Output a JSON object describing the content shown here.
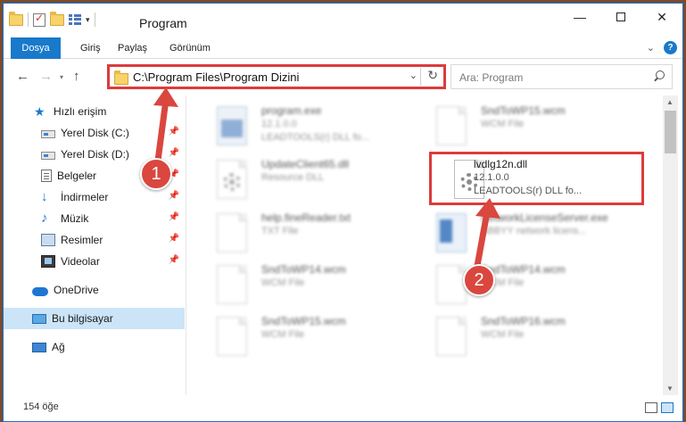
{
  "window": {
    "title": "Program",
    "controls": {
      "minimize": "—",
      "maximize": "",
      "close": "✕"
    }
  },
  "ribbon": {
    "tabs": [
      "Dosya",
      "Giriş",
      "Paylaş",
      "Görünüm"
    ],
    "expand_glyph": "⌄",
    "help_glyph": "?"
  },
  "navigation": {
    "back_glyph": "←",
    "forward_glyph": "→",
    "recent_glyph": "▾",
    "up_glyph": "↑",
    "address": "C:\\Program Files\\Program Dizini",
    "address_dropdown_glyph": "⌄",
    "refresh_glyph": "↻",
    "search_placeholder": "Ara: Program"
  },
  "sidebar": {
    "pin_glyph": "📌",
    "items": [
      {
        "label": "Hızlı erişim",
        "icon": "star-icon",
        "pinned": false
      },
      {
        "label": "Yerel Disk (C:)",
        "icon": "disk-icon",
        "pinned": true
      },
      {
        "label": "Yerel Disk (D:)",
        "icon": "disk-icon",
        "pinned": true
      },
      {
        "label": "Belgeler",
        "icon": "documents-icon",
        "pinned": true
      },
      {
        "label": "İndirmeler",
        "icon": "downloads-icon",
        "pinned": true
      },
      {
        "label": "Müzik",
        "icon": "music-icon",
        "pinned": true
      },
      {
        "label": "Resimler",
        "icon": "pictures-icon",
        "pinned": true
      },
      {
        "label": "Videolar",
        "icon": "videos-icon",
        "pinned": true
      },
      {
        "label": "OneDrive",
        "icon": "cloud-icon",
        "pinned": false
      },
      {
        "label": "Bu bilgisayar",
        "icon": "computer-icon",
        "pinned": false,
        "selected": true
      },
      {
        "label": "Ağ",
        "icon": "network-icon",
        "pinned": false
      }
    ]
  },
  "files": [
    {
      "name": "program.exe",
      "line2": "12.1.0.0",
      "line3": "LEADTOOLS(r) DLL fo...",
      "icon": "exe-icon",
      "blurred": true
    },
    {
      "name": "SndToWP15.wcm",
      "line2": "WCM File",
      "line3": "",
      "icon": "document-icon",
      "blurred": true
    },
    {
      "name": "UpdateClient65.dll",
      "line2": "Resource DLL",
      "line3": "",
      "icon": "dll-gear-icon",
      "blurred": true
    },
    {
      "name": "lvdlg12n.dll",
      "line2": "12.1.0.0",
      "line3": "LEADTOOLS(r) DLL fo...",
      "icon": "dll-gear-icon",
      "blurred": false,
      "highlighted": true
    },
    {
      "name": "help.fineReader.txt",
      "line2": "TXT File",
      "line3": "",
      "icon": "document-icon",
      "blurred": true
    },
    {
      "name": "NetworkLicenseServer.exe",
      "line2": "ABBYY network licens...",
      "line3": "",
      "icon": "network-app-icon",
      "blurred": true
    },
    {
      "name": "SndToWP14.wcm",
      "line2": "WCM File",
      "line3": "",
      "icon": "document-icon",
      "blurred": true
    },
    {
      "name": "SndToWP14.wcm",
      "line2": "WCM File",
      "line3": "",
      "icon": "document-icon",
      "blurred": true
    },
    {
      "name": "SndToWP15.wcm",
      "line2": "WCM File",
      "line3": "",
      "icon": "document-icon",
      "blurred": true
    },
    {
      "name": "SndToWP16.wcm",
      "line2": "WCM File",
      "line3": "",
      "icon": "document-icon",
      "blurred": true
    }
  ],
  "status": {
    "item_count": "154 öğe"
  },
  "annotations": {
    "step1": "1",
    "step2": "2",
    "color": "#d9473f"
  }
}
